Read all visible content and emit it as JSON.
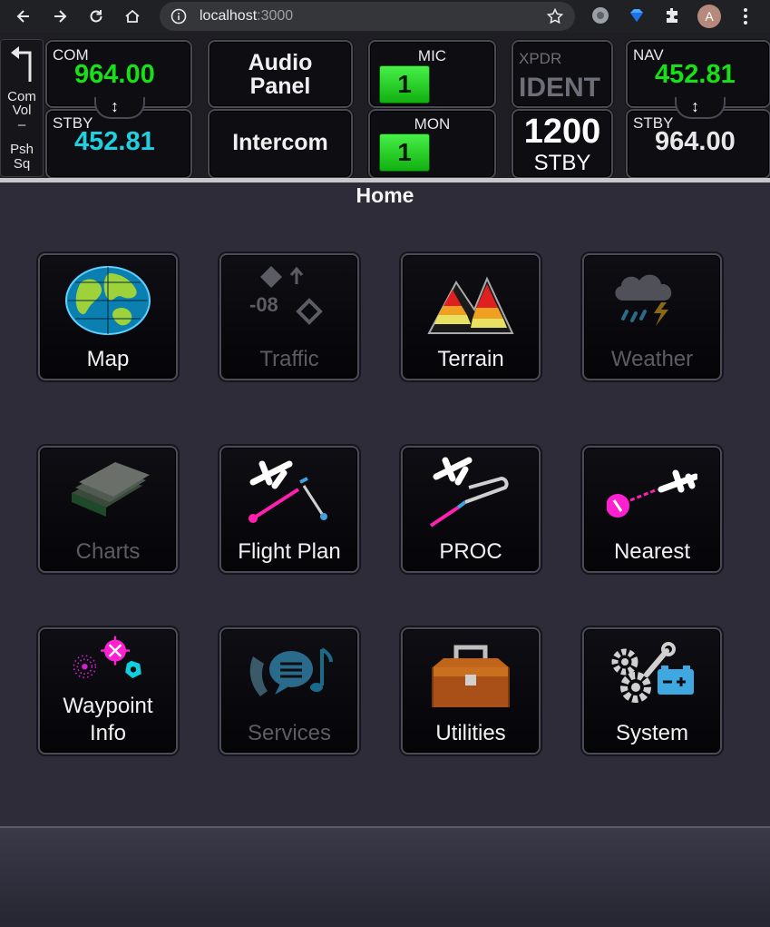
{
  "browser": {
    "url_host": "localhost",
    "url_port": ":3000",
    "avatar_letter": "A"
  },
  "left_knob": {
    "line1": "Com",
    "line2": "Vol",
    "dash": "–",
    "line3": "Psh",
    "line4": "Sq"
  },
  "com": {
    "label": "COM",
    "active": "964.00",
    "standby_label": "STBY",
    "standby": "452.81",
    "swap_glyph": "↕"
  },
  "audio": {
    "audio_panel_line1": "Audio",
    "audio_panel_line2": "Panel",
    "intercom": "Intercom"
  },
  "mic": {
    "mic_label": "MIC",
    "mic_value": "1",
    "mon_label": "MON",
    "mon_value": "1"
  },
  "xpdr": {
    "label": "XPDR",
    "ident": "IDENT",
    "code": "1200",
    "mode": "STBY"
  },
  "nav": {
    "label": "NAV",
    "active": "452.81",
    "standby_label": "STBY",
    "standby": "964.00",
    "swap_glyph": "↕"
  },
  "page_title": "Home",
  "tiles": [
    {
      "label": "Map",
      "icon": "globe-icon",
      "enabled": true
    },
    {
      "label": "Traffic",
      "icon": "traffic-icon",
      "enabled": false,
      "icon_text": "-08"
    },
    {
      "label": "Terrain",
      "icon": "terrain-icon",
      "enabled": true
    },
    {
      "label": "Weather",
      "icon": "weather-icon",
      "enabled": false
    },
    {
      "label": "Charts",
      "icon": "charts-icon",
      "enabled": false
    },
    {
      "label": "Flight Plan",
      "icon": "flight-plan-icon",
      "enabled": true
    },
    {
      "label": "PROC",
      "icon": "procedure-icon",
      "enabled": true
    },
    {
      "label": "Nearest",
      "icon": "nearest-icon",
      "enabled": true
    },
    {
      "label_line1": "Waypoint",
      "label_line2": "Info",
      "icon": "waypoint-info-icon",
      "enabled": true
    },
    {
      "label": "Services",
      "icon": "services-icon",
      "enabled": false
    },
    {
      "label": "Utilities",
      "icon": "toolbox-icon",
      "enabled": true
    },
    {
      "label": "System",
      "icon": "system-icon",
      "enabled": true
    }
  ],
  "colors": {
    "active_freq": "#18e018",
    "standby_freq": "#20d0e0",
    "background": "#2e2c38"
  }
}
